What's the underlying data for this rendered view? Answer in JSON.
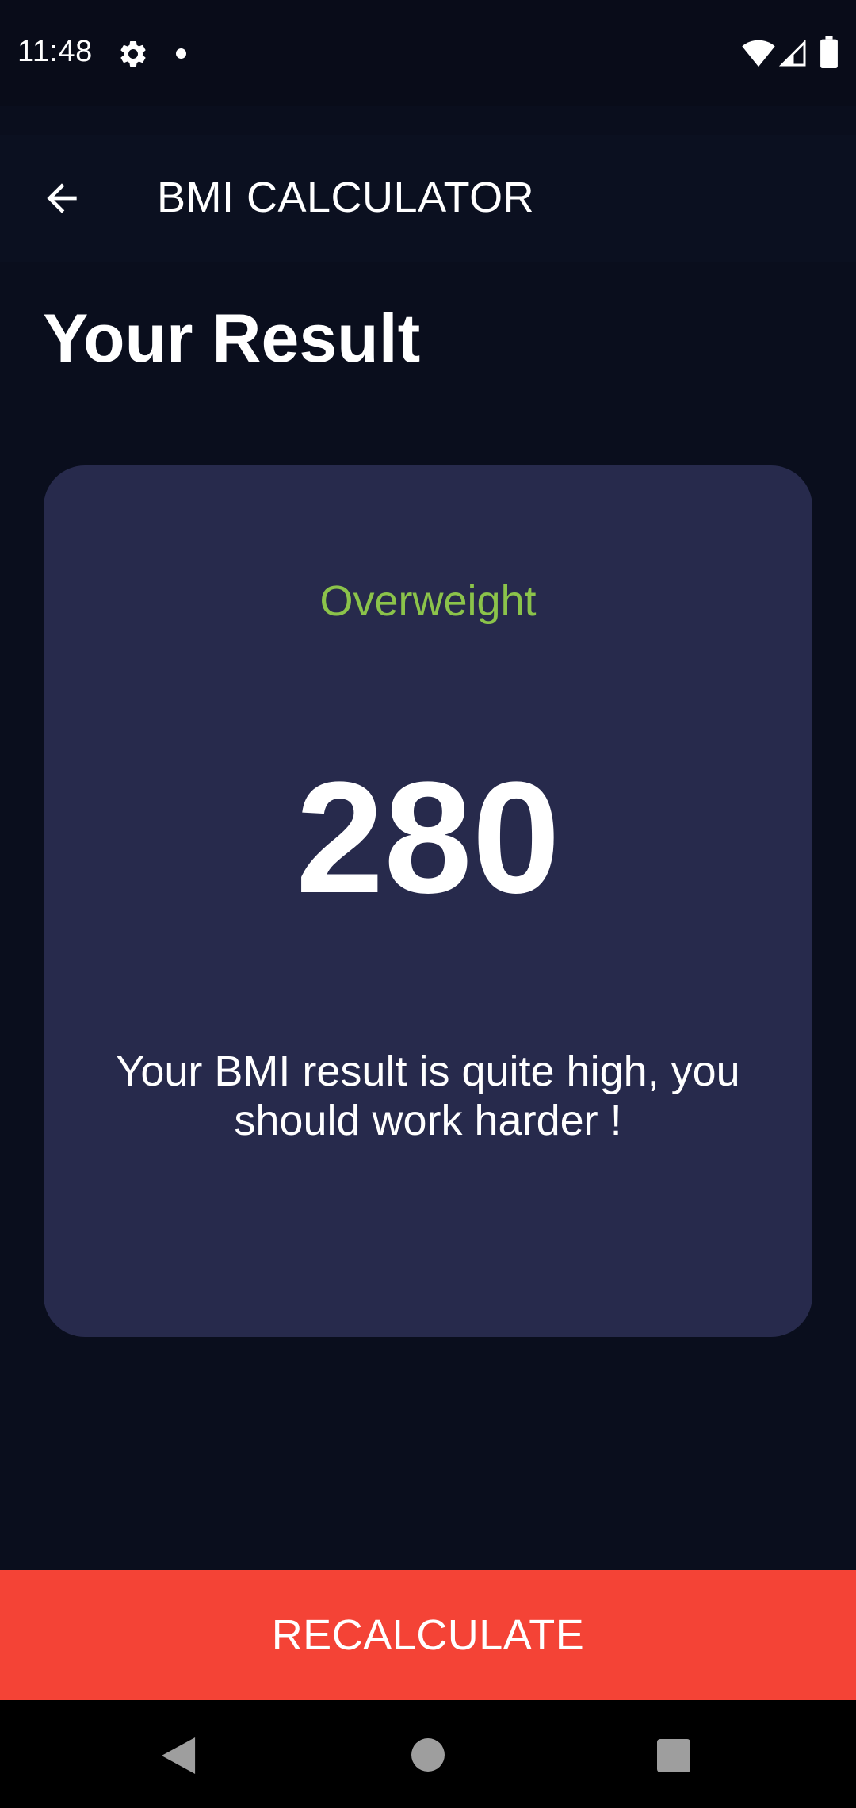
{
  "status_bar": {
    "time": "11:48",
    "icons": [
      "gear-icon",
      "notification-dot-icon",
      "wifi-icon",
      "signal-icon",
      "battery-icon"
    ]
  },
  "app_bar": {
    "title": "BMI CALCULATOR",
    "back_icon": "arrow-back-icon"
  },
  "page": {
    "title": "Your Result"
  },
  "result": {
    "category": "Overweight",
    "bmi_value": "280",
    "message": "Your BMI result is quite high, you should work harder !"
  },
  "actions": {
    "recalculate_label": "RECALCULATE"
  },
  "nav_bar": {
    "icons": [
      "nav-back-icon",
      "nav-home-icon",
      "nav-recents-icon"
    ]
  },
  "colors": {
    "background": "#0a0e1d",
    "app_bar": "#0b1020",
    "card": "#272a4c",
    "category_green": "#8bc34a",
    "button_red": "#f44336"
  }
}
